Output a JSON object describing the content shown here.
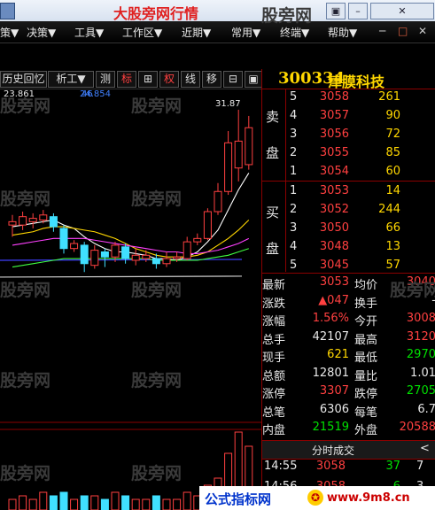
{
  "window": {
    "title": "大股旁网行情",
    "title_color": "#e02020",
    "controls": [
      "▣",
      "–",
      "✕"
    ]
  },
  "menu": {
    "items": [
      {
        "label": "策▼"
      },
      {
        "label": "决策▼"
      },
      {
        "label": "工具▼"
      },
      {
        "label": "工作区▼"
      },
      {
        "label": "近期▼"
      },
      {
        "label": "常用▼"
      },
      {
        "label": "终端▼"
      },
      {
        "label": "帮助▼"
      }
    ],
    "window_controls": [
      "─",
      "□",
      "✕"
    ]
  },
  "toolbar": {
    "buttons": [
      {
        "label": "历史回忆",
        "active": false
      },
      {
        "label": "析工▼",
        "active": false
      },
      {
        "label": "测",
        "active": false
      },
      {
        "label": "标",
        "active": true
      },
      {
        "label": "⊞",
        "active": false
      },
      {
        "label": "权",
        "active": true
      },
      {
        "label": "线",
        "active": false
      },
      {
        "label": "移",
        "active": false
      },
      {
        "label": "⊟",
        "active": false
      },
      {
        "label": "▣",
        "active": false
      }
    ]
  },
  "chart_info": {
    "price_label": "23.861",
    "ma_label_1": "46",
    "ma_label_2": "24.854"
  },
  "chart_data": {
    "type": "candlestick",
    "peak_label": "31.87",
    "candles": [
      {
        "o": 25.2,
        "c": 25.0,
        "h": 25.6,
        "l": 24.3,
        "dir": "up"
      },
      {
        "o": 25.0,
        "c": 25.5,
        "h": 25.8,
        "l": 24.7,
        "dir": "up"
      },
      {
        "o": 25.4,
        "c": 25.2,
        "h": 25.7,
        "l": 24.8,
        "dir": "up"
      },
      {
        "o": 25.3,
        "c": 25.6,
        "h": 25.9,
        "l": 25.1,
        "dir": "up"
      },
      {
        "o": 25.5,
        "c": 24.9,
        "h": 25.7,
        "l": 24.6,
        "dir": "down"
      },
      {
        "o": 24.8,
        "c": 23.6,
        "h": 25.0,
        "l": 23.3,
        "dir": "down"
      },
      {
        "o": 23.6,
        "c": 23.9,
        "h": 24.1,
        "l": 23.4,
        "dir": "up"
      },
      {
        "o": 23.8,
        "c": 22.7,
        "h": 24.0,
        "l": 22.2,
        "dir": "down"
      },
      {
        "o": 22.6,
        "c": 23.5,
        "h": 23.8,
        "l": 22.4,
        "dir": "up"
      },
      {
        "o": 23.4,
        "c": 23.1,
        "h": 23.6,
        "l": 22.5,
        "dir": "down"
      },
      {
        "o": 23.1,
        "c": 23.8,
        "h": 24.0,
        "l": 22.8,
        "dir": "up"
      },
      {
        "o": 23.7,
        "c": 23.0,
        "h": 23.9,
        "l": 22.7,
        "dir": "down"
      },
      {
        "o": 22.9,
        "c": 23.2,
        "h": 23.6,
        "l": 22.6,
        "dir": "up"
      },
      {
        "o": 23.2,
        "c": 23.0,
        "h": 23.5,
        "l": 22.8,
        "dir": "up"
      },
      {
        "o": 23.0,
        "c": 22.7,
        "h": 23.3,
        "l": 22.4,
        "dir": "down"
      },
      {
        "o": 22.7,
        "c": 23.0,
        "h": 23.4,
        "l": 22.5,
        "dir": "up"
      },
      {
        "o": 23.0,
        "c": 23.1,
        "h": 23.4,
        "l": 22.8,
        "dir": "up"
      },
      {
        "o": 23.0,
        "c": 24.0,
        "h": 24.3,
        "l": 22.9,
        "dir": "up"
      },
      {
        "o": 24.0,
        "c": 24.2,
        "h": 24.5,
        "l": 23.8,
        "dir": "up"
      },
      {
        "o": 24.2,
        "c": 25.8,
        "h": 26.0,
        "l": 24.1,
        "dir": "up"
      },
      {
        "o": 25.8,
        "c": 27.0,
        "h": 27.5,
        "l": 25.6,
        "dir": "up"
      },
      {
        "o": 27.0,
        "c": 29.9,
        "h": 30.6,
        "l": 26.8,
        "dir": "up"
      },
      {
        "o": 30.0,
        "c": 28.4,
        "h": 31.87,
        "l": 27.6,
        "dir": "up"
      },
      {
        "o": 28.6,
        "c": 30.8,
        "h": 31.5,
        "l": 28.3,
        "dir": "up"
      }
    ],
    "ma_series": [
      {
        "name": "MA5",
        "color": "#ffffff",
        "values": [
          24.9,
          25.0,
          25.1,
          25.2,
          25.3,
          25.0,
          24.8,
          24.3,
          23.9,
          23.6,
          23.4,
          23.4,
          23.3,
          23.2,
          23.0,
          23.0,
          22.9,
          23.1,
          23.4,
          24.0,
          24.7,
          25.9,
          27.1,
          28.1
        ]
      },
      {
        "name": "MA10",
        "color": "#ffd700",
        "values": [
          24.4,
          24.5,
          24.6,
          24.8,
          24.9,
          24.9,
          24.8,
          24.7,
          24.6,
          24.4,
          24.2,
          23.9,
          23.6,
          23.4,
          23.2,
          23.1,
          23.1,
          23.1,
          23.2,
          23.4,
          23.8,
          24.2,
          24.7,
          25.3
        ]
      },
      {
        "name": "MA20",
        "color": "#ff40ff",
        "values": [
          23.8,
          23.9,
          24.0,
          24.1,
          24.2,
          24.2,
          24.2,
          24.2,
          24.1,
          24.0,
          23.9,
          23.8,
          23.7,
          23.6,
          23.5,
          23.4,
          23.4,
          23.3,
          23.3,
          23.4,
          23.5,
          23.7,
          23.9,
          24.2
        ]
      },
      {
        "name": "MA30",
        "color": "#40ff40",
        "values": [
          22.5,
          22.6,
          22.7,
          22.8,
          22.9,
          23.0,
          23.0,
          23.0,
          23.0,
          23.0,
          23.0,
          23.0,
          23.0,
          23.0,
          22.9,
          22.9,
          22.9,
          22.9,
          22.9,
          23.0,
          23.1,
          23.2,
          23.4,
          23.6
        ]
      }
    ],
    "level_lines": [
      {
        "value": 22.9,
        "color": "#4040ff"
      },
      {
        "value": 21.9,
        "color": "#cccccc"
      }
    ],
    "ylim": [
      21.0,
      32.5
    ],
    "volumes": [
      3,
      4,
      3,
      5,
      4,
      5,
      3,
      4,
      4,
      3,
      5,
      4,
      3,
      3,
      4,
      3,
      3,
      5,
      4,
      7,
      9,
      16,
      22,
      18
    ]
  },
  "stock": {
    "code": "300334",
    "name": "津膜科技"
  },
  "orderbook": {
    "sell_label": [
      "卖",
      "盘"
    ],
    "buy_label": [
      "买",
      "盘"
    ],
    "asks": [
      {
        "level": "5",
        "price": "3058",
        "vol": "261"
      },
      {
        "level": "4",
        "price": "3057",
        "vol": "90"
      },
      {
        "level": "3",
        "price": "3056",
        "vol": "72"
      },
      {
        "level": "2",
        "price": "3055",
        "vol": "85"
      },
      {
        "level": "1",
        "price": "3054",
        "vol": "60"
      }
    ],
    "bids": [
      {
        "level": "1",
        "price": "3053",
        "vol": "14"
      },
      {
        "level": "2",
        "price": "3052",
        "vol": "244"
      },
      {
        "level": "3",
        "price": "3050",
        "vol": "66"
      },
      {
        "level": "4",
        "price": "3048",
        "vol": "13"
      },
      {
        "level": "5",
        "price": "3045",
        "vol": "57"
      }
    ]
  },
  "stats": {
    "rows": [
      {
        "l1": "最新",
        "v1": "3053",
        "c1": "red",
        "l2": "均价",
        "v2": "3040",
        "c2": "red"
      },
      {
        "l1": "涨跌",
        "v1": "▲047",
        "c1": "red",
        "l2": "换手",
        "v2": "-",
        "c2": "wht"
      },
      {
        "l1": "涨幅",
        "v1": "1.56%",
        "c1": "red",
        "l2": "今开",
        "v2": "3008",
        "c2": "red"
      },
      {
        "l1": "总手",
        "v1": "42107",
        "c1": "wht",
        "l2": "最高",
        "v2": "3120",
        "c2": "red"
      },
      {
        "l1": "现手",
        "v1": "621",
        "c1": "yel",
        "l2": "最低",
        "v2": "2970",
        "c2": "grn"
      },
      {
        "l1": "总额",
        "v1": "12801",
        "c1": "wht",
        "l2": "量比",
        "v2": "1.01",
        "c2": "wht"
      },
      {
        "l1": "涨停",
        "v1": "3307",
        "c1": "red",
        "l2": "跌停",
        "v2": "2705",
        "c2": "grn"
      },
      {
        "l1": "总笔",
        "v1": "6306",
        "c1": "wht",
        "l2": "每笔",
        "v2": "6.7",
        "c2": "wht"
      },
      {
        "l1": "内盘",
        "v1": "21519",
        "c1": "grn",
        "l2": "外盘",
        "v2": "20588",
        "c2": "red"
      }
    ]
  },
  "trades": {
    "header": "分时成交",
    "toggle": "<",
    "rows": [
      {
        "time": "14:55",
        "price": "3058",
        "vol": "37",
        "mark": "7"
      },
      {
        "time": "14:56",
        "price": "3058",
        "vol": "6",
        "mark": "3"
      }
    ]
  },
  "watermark": {
    "text": "股旁网"
  },
  "footer": {
    "label": "公式指标网",
    "badge": "✪",
    "url": "www.9m8.cn"
  }
}
